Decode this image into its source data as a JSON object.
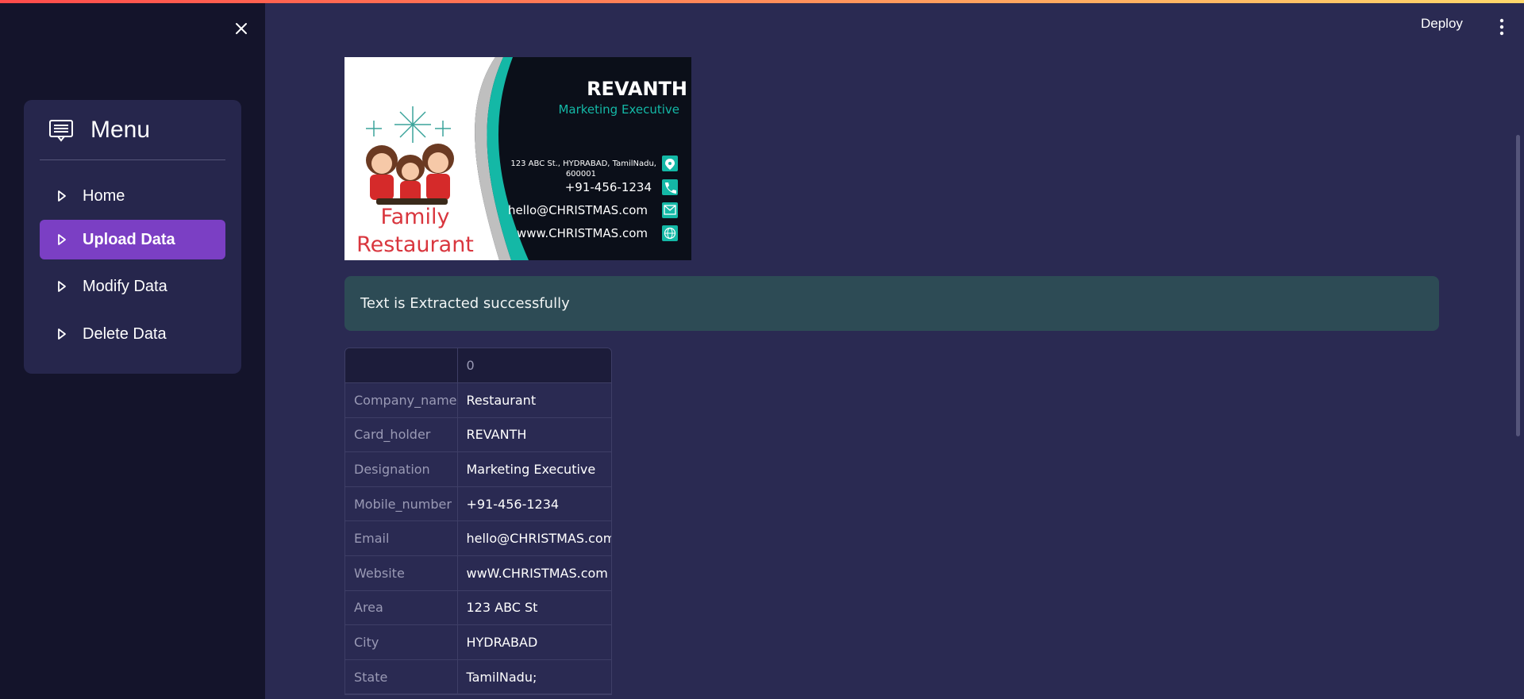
{
  "sidebar": {
    "menu_title": "Menu",
    "items": [
      {
        "label": "Home",
        "active": false
      },
      {
        "label": "Upload Data",
        "active": true
      },
      {
        "label": "Modify Data",
        "active": false
      },
      {
        "label": "Delete Data",
        "active": false
      }
    ],
    "active_color": "#7b3fc4"
  },
  "header": {
    "deploy_label": "Deploy"
  },
  "business_card": {
    "name": "REVANTH",
    "designation": "Marketing Executive",
    "address_line1": "123 ABC St., HYDRABAD, TamilNadu,",
    "address_line2": "600001",
    "phone": "+91-456-1234",
    "email": "hello@CHRISTMAS.com",
    "website": "www.CHRISTMAS.com",
    "company_line1": "Family",
    "company_line2": "Restaurant",
    "accent_color": "#14b8a6"
  },
  "alert": {
    "message": "Text is Extracted successfully"
  },
  "table": {
    "column_header": "0",
    "rows": [
      {
        "key": "Company_name",
        "value": "Restaurant"
      },
      {
        "key": "Card_holder",
        "value": "REVANTH"
      },
      {
        "key": "Designation",
        "value": "Marketing Executive"
      },
      {
        "key": "Mobile_number",
        "value": "+91-456-1234"
      },
      {
        "key": "Email",
        "value": "hello@CHRISTMAS.com"
      },
      {
        "key": "Website",
        "value": "wwW.CHRISTMAS.com"
      },
      {
        "key": "Area",
        "value": "123 ABC St"
      },
      {
        "key": "City",
        "value": "HYDRABAD"
      },
      {
        "key": "State",
        "value": "TamilNadu;"
      }
    ]
  }
}
